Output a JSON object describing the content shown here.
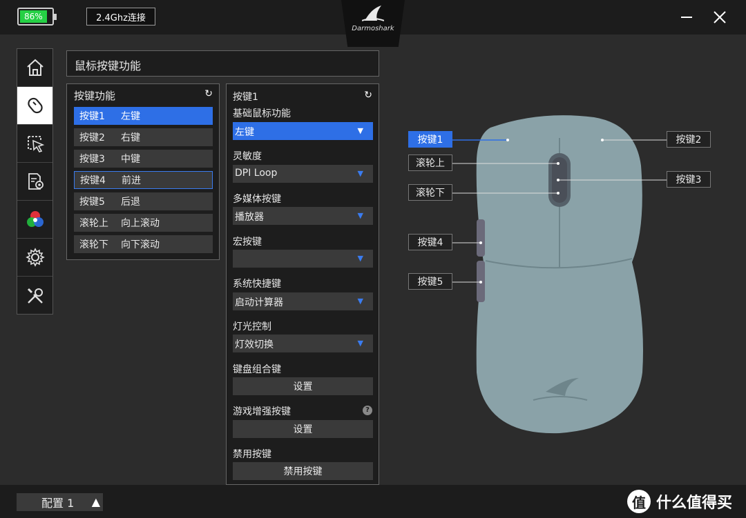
{
  "topbar": {
    "battery_text": "86%",
    "battery_level": 0.86,
    "connection_label": "2.4Ghz连接",
    "logo_text": "Darmoshark",
    "minimize_icon": "minimize-icon",
    "close_icon": "close-icon"
  },
  "sidebar": {
    "items": [
      {
        "icon": "home-icon",
        "active": false
      },
      {
        "icon": "mouse-icon",
        "active": true
      },
      {
        "icon": "pointer-icon",
        "active": false
      },
      {
        "icon": "macro-settings-icon",
        "active": false
      },
      {
        "icon": "color-icon",
        "active": false
      },
      {
        "icon": "gear-icon",
        "active": false
      },
      {
        "icon": "tools-icon",
        "active": false
      }
    ]
  },
  "panel": {
    "title": "鼠标按键功能"
  },
  "key_list": {
    "header": "按键功能",
    "rows": [
      {
        "key": "按键1",
        "func": "左键"
      },
      {
        "key": "按键2",
        "func": "右键"
      },
      {
        "key": "按键3",
        "func": "中键"
      },
      {
        "key": "按键4",
        "func": "前进"
      },
      {
        "key": "按键5",
        "func": "后退"
      },
      {
        "key": "滚轮上",
        "func": "向上滚动"
      },
      {
        "key": "滚轮下",
        "func": "向下滚动"
      }
    ]
  },
  "settings": {
    "header": "按键1",
    "basic_label": "基础鼠标功能",
    "basic_value": "左键",
    "sensitivity_label": "灵敏度",
    "sensitivity_value": "DPI Loop",
    "media_label": "多媒体按键",
    "media_value": "播放器",
    "macro_label": "宏按键",
    "macro_value": "",
    "shortcut_label": "系统快捷键",
    "shortcut_value": "启动计算器",
    "light_label": "灯光控制",
    "light_value": "灯效切换",
    "combo_label": "键盘组合键",
    "combo_button": "设置",
    "game_label": "游戏增强按键",
    "game_button": "设置",
    "disable_label": "禁用按键",
    "disable_button": "禁用按键",
    "help_mark": "?"
  },
  "callouts": {
    "b1": "按键1",
    "b2": "按键2",
    "scroll_up": "滚轮上",
    "b3": "按键3",
    "scroll_down": "滚轮下",
    "b4": "按键4",
    "b5": "按键5"
  },
  "bottombar": {
    "profile_label": "配置 1",
    "watermark_text": "什么值得买",
    "watermark_mark": "值"
  },
  "colors": {
    "accent": "#2e6fe6",
    "battery": "#25d045",
    "mouse_body": "#8aa2a8"
  }
}
